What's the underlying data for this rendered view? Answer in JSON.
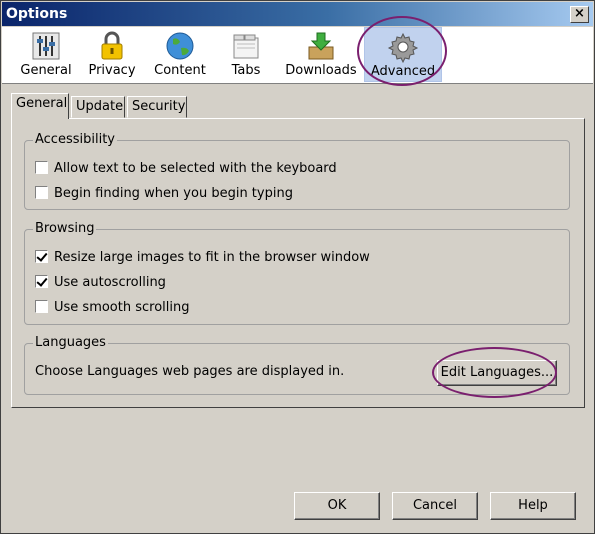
{
  "window": {
    "title": "Options",
    "close_label": "×"
  },
  "toolbar": {
    "items": [
      {
        "label": "General",
        "icon": "sliders-icon"
      },
      {
        "label": "Privacy",
        "icon": "padlock-icon"
      },
      {
        "label": "Content",
        "icon": "globe-icon"
      },
      {
        "label": "Tabs",
        "icon": "tabs-icon"
      },
      {
        "label": "Downloads",
        "icon": "download-box-icon"
      },
      {
        "label": "Advanced",
        "icon": "gear-icon",
        "selected": true
      }
    ]
  },
  "tabs": [
    {
      "label": "General",
      "active": true
    },
    {
      "label": "Update"
    },
    {
      "label": "Security"
    }
  ],
  "accessibility": {
    "legend": "Accessibility",
    "options": [
      {
        "label": "Allow text to be selected with the keyboard",
        "checked": false
      },
      {
        "label": "Begin finding when you begin typing",
        "checked": false
      }
    ]
  },
  "browsing": {
    "legend": "Browsing",
    "options": [
      {
        "label": "Resize large images to fit in the browser window",
        "checked": true
      },
      {
        "label": "Use autoscrolling",
        "checked": true
      },
      {
        "label": "Use smooth scrolling",
        "checked": false
      }
    ]
  },
  "languages": {
    "legend": "Languages",
    "description": "Choose Languages web pages are displayed in.",
    "button_label": "Edit Languages..."
  },
  "footer": {
    "ok_label": "OK",
    "cancel_label": "Cancel",
    "help_label": "Help"
  },
  "colors": {
    "title_start": "#0a246a",
    "title_end": "#a6caf0",
    "annotation_ring": "#7a1f6e",
    "selected_bg": "#c1d2ee"
  }
}
